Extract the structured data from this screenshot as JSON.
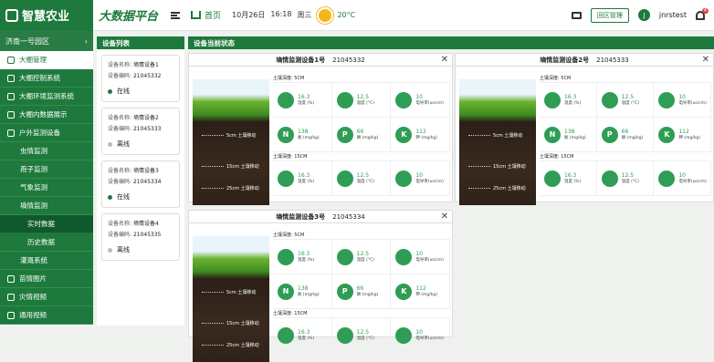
{
  "header": {
    "brand": "智慧农业",
    "platform": "大数据平台",
    "home": "首页",
    "date": "10月26日",
    "time": "16:18",
    "weekday": "周三",
    "temperature": "20°C",
    "backend_btn": "回区管理",
    "user_initial": "J",
    "username": "jnrstest",
    "notif_count": "4"
  },
  "sidebar": {
    "region": "济南一号园区",
    "items": [
      {
        "label": "大棚管理"
      },
      {
        "label": "大棚控制系统"
      },
      {
        "label": "大棚环境监测系统"
      },
      {
        "label": "大棚内数据展示"
      },
      {
        "label": "户外监测设备"
      },
      {
        "label": "虫情监测"
      },
      {
        "label": "孢子监测"
      },
      {
        "label": "气象监测"
      },
      {
        "label": "墒情监测"
      },
      {
        "label": "实时数据"
      },
      {
        "label": "历史数据"
      },
      {
        "label": "灌溉系统"
      },
      {
        "label": "苗情图片"
      },
      {
        "label": "灾情视频"
      },
      {
        "label": "通用视频"
      }
    ]
  },
  "device_list": {
    "title": "设备列表",
    "name_label": "设备名称:",
    "code_label": "设备编码:",
    "devices": [
      {
        "name": "墒情设备1",
        "code": "21045332",
        "status": "在线"
      },
      {
        "name": "墒情设备2",
        "code": "21045333",
        "status": "离线"
      },
      {
        "name": "墒情设备3",
        "code": "21045334",
        "status": "在线"
      },
      {
        "name": "墒情设备4",
        "code": "21045335",
        "status": "离线"
      }
    ]
  },
  "status_panel": {
    "title": "设备当前状态",
    "cards": [
      {
        "title": "墒情监测设备1号",
        "code": "21045332"
      },
      {
        "title": "墒情监测设备2号",
        "code": "21045333"
      },
      {
        "title": "墒情监测设备3号",
        "code": "21045334"
      }
    ],
    "depth1": "土壤深度: 5CM",
    "depth2": "土壤深度: 15CM",
    "img_5": "5cm 土壤移动",
    "img_15": "15cm 土壤移动",
    "img_25": "25cm 土壤移动",
    "row1": [
      {
        "val": "16.3",
        "unit": "温度 (%)"
      },
      {
        "val": "12.5",
        "unit": "温度 (°C)"
      },
      {
        "val": "10",
        "unit": "电导率(us/cm)"
      }
    ],
    "row2": [
      {
        "icon": "N",
        "val": "138",
        "unit": "氮 (mg/kg)"
      },
      {
        "icon": "P",
        "val": "66",
        "unit": "磷 (mg/kg)"
      },
      {
        "icon": "K",
        "val": "112",
        "unit": "钾 (mg/kg)"
      }
    ]
  },
  "colors": {
    "primary": "#1d7a3c",
    "online": "#1d7a3c",
    "offline": "#bbbbbb"
  }
}
